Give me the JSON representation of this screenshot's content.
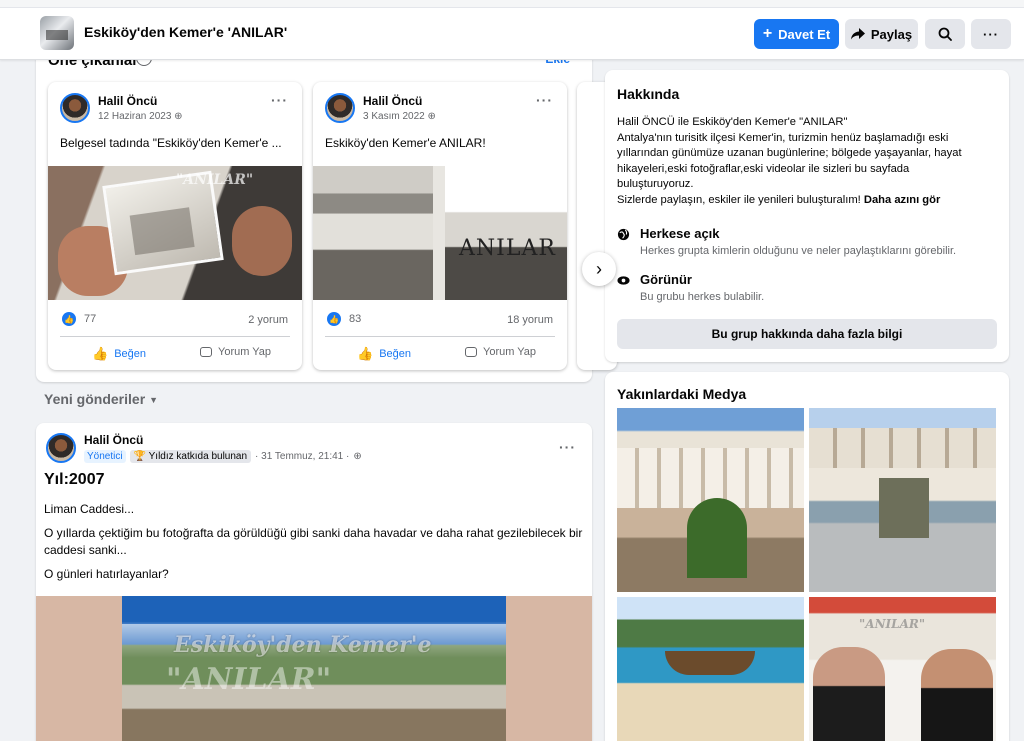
{
  "header": {
    "group_title": "Eskiköy'den Kemer'e 'ANILAR'",
    "invite_label": "Davet Et",
    "share_label": "Paylaş"
  },
  "featured": {
    "title": "Öne çıkanlar",
    "edit_label": "Ekle",
    "cards": [
      {
        "author": "Halil Öncü",
        "date": "12 Haziran 2023",
        "text": "Belgesel tadında \"Eskiköy'den Kemer'e ...",
        "image_watermark": "\"ANILAR\"",
        "likes": "77",
        "comments": "2 yorum",
        "like_label": "Beğen",
        "comment_label": "Yorum Yap"
      },
      {
        "author": "Halil Öncü",
        "date": "3 Kasım 2022",
        "text": "Eskiköy'den Kemer'e ANILAR!",
        "image_title": "ANILAR",
        "likes": "83",
        "comments": "18 yorum",
        "like_label": "Beğen",
        "comment_label": "Yorum Yap"
      }
    ]
  },
  "feed": {
    "sort_label": "Yeni gönderiler",
    "post": {
      "author": "Halil Öncü",
      "role": "Yönetici",
      "badge": "Yıldız katkıda bulunan",
      "timestamp": "· 31 Temmuz, 21:41 ·",
      "year_line": "Yıl:2007",
      "line1": "Liman Caddesi...",
      "line2": "O yıllarda çektiğim bu fotoğrafta da görüldüğü gibi sanki daha havadar ve daha rahat gezilebilecek bir caddesi sanki...",
      "line3": "O günleri hatırlayanlar?",
      "watermark_1": "Eskiköy'den Kemer'e",
      "watermark_2": "\"ANILAR\""
    }
  },
  "about": {
    "title": "Hakkında",
    "desc_lines": [
      "Halil ÖNCÜ ile Eskiköy'den Kemer'e \"ANILAR\"",
      "Antalya'nın turisitk ilçesi Kemer'in, turizmin henüz başlamadığı eski",
      "yıllarından günümüze uzanan bugünlerine; bölgede yaşayanlar, hayat",
      "hikayeleri,eski fotoğraflar,eski videolar ile sizleri bu sayfada",
      "buluşturuyoruz."
    ],
    "desc_last": "Sizlerde paylaşın, eskiler ile yenileri buluşturalım!",
    "see_more": "Daha azını gör",
    "public_title": "Herkese açık",
    "public_desc": "Herkes grupta kimlerin olduğunu ve neler paylaştıklarını görebilir.",
    "visible_title": "Görünür",
    "visible_desc": "Bu grubu herkes bulabilir.",
    "more_info_label": "Bu grup hakkında daha fazla bilgi"
  },
  "media": {
    "title": "Yakınlardaki Medya",
    "tile4_watermark": "\"ANILAR\""
  },
  "colors": {
    "accent": "#1877f2",
    "page_bg": "#f0f2f5",
    "secondary_button": "#e4e6eb"
  },
  "icons": {
    "invite": "plus-icon",
    "share": "share-arrow-icon",
    "search": "search-icon",
    "more": "more-dots-icon",
    "info": "info-icon",
    "public": "globe-icon",
    "visible": "eye-icon"
  }
}
